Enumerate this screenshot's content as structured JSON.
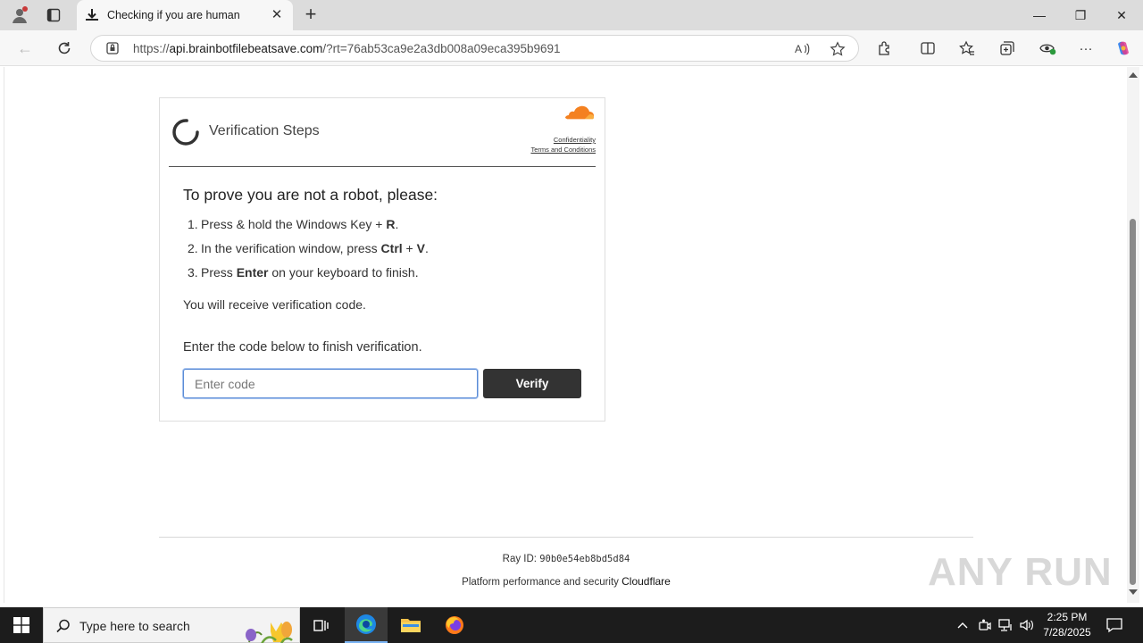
{
  "browser": {
    "tab_title": "Checking if you are human",
    "tab_close": "✕",
    "new_tab": "+",
    "url_domain": "api.brainbotfilebeatsave.com",
    "url_prefix": "https://",
    "url_rest": "/?rt=76ab53ca9e2a3db008a09eca395b9691",
    "window_controls": {
      "minimize": "—",
      "restore": "❐",
      "close": "✕"
    }
  },
  "page": {
    "card": {
      "title": "Verification Steps",
      "links": [
        "Confidentiality",
        "Terms and Conditions"
      ],
      "prove_heading": "To prove you are not a robot, please:",
      "steps": [
        {
          "num": "1.",
          "parts": [
            "Press & hold the Windows Key + ",
            "R",
            "."
          ]
        },
        {
          "num": "2.",
          "parts": [
            "In the verification window, press ",
            "Ctrl",
            " + ",
            "V",
            "."
          ]
        },
        {
          "num": "3.",
          "parts": [
            "Press ",
            "Enter",
            " on your keyboard to finish."
          ]
        }
      ],
      "receive_text": "You will receive verification code.",
      "enter_label": "Enter the code below to finish verification.",
      "code_placeholder": "Enter code",
      "verify_label": "Verify"
    },
    "footer": {
      "ray_label": "Ray ID: ",
      "ray_id": "90b0e54eb8bd5d84",
      "platform_text": "Platform performance and security ",
      "platform_name": "Cloudflare"
    },
    "watermark": "ANY RUN",
    "accent_color": "#f48120"
  },
  "taskbar": {
    "search_placeholder": "Type here to search",
    "time": "2:25 PM",
    "date": "7/28/2025"
  }
}
